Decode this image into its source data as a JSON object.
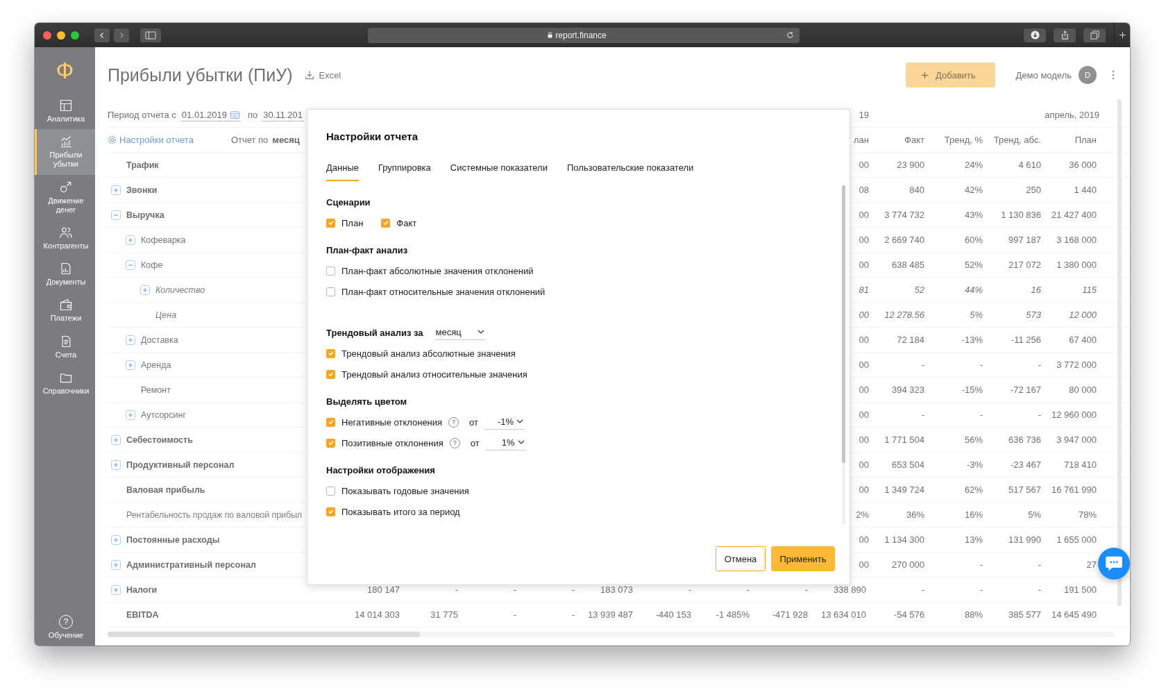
{
  "browser": {
    "url": "report.finance"
  },
  "sidebar": {
    "logo": "Ф",
    "items": [
      {
        "label": "Аналитика",
        "selected": false
      },
      {
        "label": "Прибыли убытки",
        "selected": true
      },
      {
        "label": "Движение денег",
        "selected": false
      },
      {
        "label": "Контрагенты",
        "selected": false
      },
      {
        "label": "Документы",
        "selected": false
      },
      {
        "label": "Платежи",
        "selected": false
      },
      {
        "label": "Счета",
        "selected": false
      },
      {
        "label": "Справочники",
        "selected": false
      }
    ],
    "help": {
      "mark": "?",
      "label": "Обучение"
    }
  },
  "header": {
    "title": "Прибыли убытки (ПиУ)",
    "export": "Excel",
    "add_button": "Добавить",
    "user": "Демо модель",
    "avatar": "D"
  },
  "filters": {
    "period_label": "Период отчета с",
    "date_from": "01.01.2019",
    "to_label": "по",
    "date_to": "30.11.201",
    "settings": "Настройки отчета",
    "report_by_label": "Отчет по",
    "report_by": "месяц"
  },
  "table": {
    "month_headers": [
      "19",
      "апрель, 2019"
    ],
    "columns": [
      "лан",
      "Факт",
      "Тренд, %",
      "Тренд, абс.",
      "План"
    ],
    "rows": [
      {
        "label": "Трафик",
        "kind": "group",
        "cells": [
          "00",
          "23 900",
          "24%",
          "4 610",
          "36 000"
        ]
      },
      {
        "label": "Звонки",
        "kind": "group",
        "expanded": false,
        "cells": [
          "08",
          "840",
          "42%",
          "250",
          "1 440"
        ]
      },
      {
        "label": "Выручка",
        "kind": "group",
        "expanded": true,
        "cells": [
          "00",
          "3 774 732",
          "43%",
          "1 130 836",
          "21 427 400"
        ],
        "children": [
          {
            "label": "Кофеварка",
            "kind": "item",
            "expanded": false,
            "cells": [
              "00",
              "2 669 740",
              "60%",
              "997 187",
              "3 168 000"
            ]
          },
          {
            "label": "Кофе",
            "kind": "item",
            "expanded": true,
            "cells": [
              "00",
              "638 485",
              "52%",
              "217 072",
              "1 380 000"
            ],
            "children": [
              {
                "label": "Количество",
                "kind": "metric",
                "expanded": false,
                "cells": [
                  "81",
                  "52",
                  "44%",
                  "16",
                  "115"
                ]
              },
              {
                "label": "Цена",
                "kind": "metric",
                "cells": [
                  "00",
                  "12 278.56",
                  "5%",
                  "573",
                  "12 000"
                ]
              }
            ]
          },
          {
            "label": "Доставка",
            "kind": "item",
            "expanded": false,
            "cells": [
              "00",
              "72 184",
              "-13%",
              "-11 256",
              "67 400"
            ]
          },
          {
            "label": "Аренда",
            "kind": "item",
            "expanded": false,
            "cells": [
              "00",
              "-",
              "-",
              "-",
              "3 772 000"
            ]
          },
          {
            "label": "Ремонт",
            "kind": "item",
            "cells": [
              "00",
              "394 323",
              "-15%",
              "-72 167",
              "80 000"
            ]
          },
          {
            "label": "Аутсорсинг",
            "kind": "item",
            "expanded": false,
            "cells": [
              "00",
              "-",
              "-",
              "-",
              "12 960 000"
            ]
          }
        ]
      },
      {
        "label": "Себестоимость",
        "kind": "group",
        "expanded": false,
        "cells": [
          "00",
          "1 771 504",
          "56%",
          "636 736",
          "3 947 000"
        ]
      },
      {
        "label": "Продуктивный персонал",
        "kind": "group",
        "expanded": false,
        "cells": [
          "00",
          "653 504",
          "-3%",
          "-23 467",
          "718 410"
        ]
      },
      {
        "label": "Валовая прибыль",
        "kind": "group",
        "cells": [
          "00",
          "1 349 724",
          "62%",
          "517 567",
          "16 761 990"
        ]
      },
      {
        "label": "Рентабельность продаж по валовой прибыл",
        "kind": "ratio",
        "cells": [
          "2%",
          "36%",
          "16%",
          "5%",
          "78%"
        ]
      },
      {
        "label": "Постоянные расходы",
        "kind": "group",
        "expanded": false,
        "cells": [
          "00",
          "1 134 300",
          "13%",
          "131 990",
          "1 655 000"
        ]
      },
      {
        "label": "Административный персонал",
        "kind": "group",
        "expanded": false,
        "cells": [
          "00",
          "270 000",
          "-",
          "-",
          "27"
        ]
      },
      {
        "label": "Налоги",
        "kind": "group",
        "expanded": false,
        "cells": [
          "180 147",
          "-",
          "-",
          "-",
          "183 073",
          "-",
          "-",
          "-",
          "338 890",
          "-",
          "-",
          "-",
          "191 500"
        ]
      },
      {
        "label": "EBITDA",
        "kind": "group",
        "cells": [
          "14 014 303",
          "31 775",
          "-",
          "-",
          "13 939 487",
          "-440 153",
          "-1 485%",
          "-471 928",
          "13 634 010",
          "-54 576",
          "88%",
          "385 577",
          "14 645 490"
        ]
      }
    ]
  },
  "dialog": {
    "title": "Настройки отчета",
    "tabs": [
      {
        "label": "Данные",
        "selected": true
      },
      {
        "label": "Группировка",
        "selected": false
      },
      {
        "label": "Системные показатели",
        "selected": false
      },
      {
        "label": "Пользовательские показатели",
        "selected": false
      }
    ],
    "sections": [
      {
        "title": "Сценарии",
        "kind": "inline",
        "options": [
          {
            "kind": "check",
            "label": "План",
            "checked": true
          },
          {
            "kind": "check",
            "label": "Факт",
            "checked": true
          }
        ]
      },
      {
        "title": "План-факт анализ",
        "kind": "stack",
        "options": [
          {
            "kind": "check",
            "label": "План-факт абсолютные значения отклонений",
            "checked": false
          },
          {
            "kind": "check",
            "label": "План-факт относительные значения отклонений",
            "checked": false
          }
        ]
      },
      {
        "title": "Трендовый анализ за",
        "kind": "stack",
        "select": "месяц",
        "options": [
          {
            "kind": "check",
            "label": "Трендовый анализ абсолютные значения",
            "checked": true
          },
          {
            "kind": "check",
            "label": "Трендовый анализ относительные значения",
            "checked": true
          }
        ]
      },
      {
        "title": "Выделять цветом",
        "kind": "stack",
        "options": [
          {
            "kind": "threshold",
            "label": "Негативные отклонения",
            "checked": true,
            "hint": "?",
            "from_label": "от",
            "value": "-1%"
          },
          {
            "kind": "threshold",
            "label": "Позитивные отклонения",
            "checked": true,
            "hint": "?",
            "from_label": "от",
            "value": "1%"
          }
        ]
      },
      {
        "title": "Настройки отображения",
        "kind": "stack",
        "options": [
          {
            "kind": "check",
            "label": "Показывать годовые значения",
            "checked": false
          },
          {
            "kind": "check",
            "label": "Показывать итого за период",
            "checked": true
          }
        ]
      }
    ],
    "buttons": [
      {
        "label": "Отмена",
        "kind": "secondary"
      },
      {
        "label": "Применить",
        "kind": "primary"
      }
    ]
  }
}
